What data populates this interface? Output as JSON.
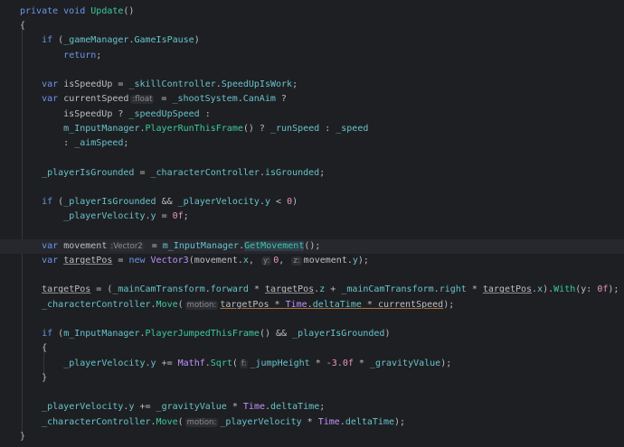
{
  "editor": {
    "current_line": 16,
    "lines": [
      [
        [
          "private void ",
          "k"
        ],
        [
          "Update",
          "m"
        ],
        [
          "()",
          "t"
        ]
      ],
      [
        [
          "{",
          "t"
        ]
      ],
      [
        [
          "    ",
          "t"
        ],
        [
          "if ",
          "k"
        ],
        [
          "(",
          "t"
        ],
        [
          "_gameManager",
          "f"
        ],
        [
          ".",
          "t"
        ],
        [
          "GameIsPause",
          "f"
        ],
        [
          ")",
          "t"
        ]
      ],
      [
        [
          "        ",
          "t"
        ],
        [
          "return",
          "k"
        ],
        [
          ";",
          "t"
        ]
      ],
      [],
      [
        [
          "    ",
          "t"
        ],
        [
          "var ",
          "k"
        ],
        [
          "isSpeedUp = ",
          "t"
        ],
        [
          "_skillController",
          "f"
        ],
        [
          ".",
          "t"
        ],
        [
          "SpeedUpIsWork",
          "f"
        ],
        [
          ";",
          "t"
        ]
      ],
      [
        [
          "    ",
          "t"
        ],
        [
          "var ",
          "k"
        ],
        [
          "currentSpeed",
          "t"
        ],
        [
          ":float",
          "h"
        ],
        [
          " = ",
          "t"
        ],
        [
          "_shootSystem",
          "f"
        ],
        [
          ".",
          "t"
        ],
        [
          "CanAim",
          "f"
        ],
        [
          " ?",
          "t"
        ]
      ],
      [
        [
          "        isSpeedUp ? ",
          "t"
        ],
        [
          "_speedUpSpeed",
          "f"
        ],
        [
          " :",
          "t"
        ]
      ],
      [
        [
          "        ",
          "t"
        ],
        [
          "m_InputManager",
          "f"
        ],
        [
          ".",
          "t"
        ],
        [
          "PlayerRunThisFrame",
          "m"
        ],
        [
          "() ? ",
          "t"
        ],
        [
          "_runSpeed",
          "f"
        ],
        [
          " : ",
          "t"
        ],
        [
          "_speed",
          "f"
        ]
      ],
      [
        [
          "        : ",
          "t"
        ],
        [
          "_aimSpeed",
          "f"
        ],
        [
          ";",
          "t"
        ]
      ],
      [],
      [
        [
          "    ",
          "t"
        ],
        [
          "_playerIsGrounded",
          "f"
        ],
        [
          " = ",
          "t"
        ],
        [
          "_characterController",
          "f"
        ],
        [
          ".",
          "t"
        ],
        [
          "isGrounded",
          "f"
        ],
        [
          ";",
          "t"
        ]
      ],
      [],
      [
        [
          "    ",
          "t"
        ],
        [
          "if ",
          "k"
        ],
        [
          "(",
          "t"
        ],
        [
          "_playerIsGrounded",
          "f"
        ],
        [
          " && ",
          "t"
        ],
        [
          "_playerVelocity",
          "f"
        ],
        [
          ".",
          "t"
        ],
        [
          "y",
          "f"
        ],
        [
          " < ",
          "t"
        ],
        [
          "0",
          "n"
        ],
        [
          ")",
          "t"
        ]
      ],
      [
        [
          "        ",
          "t"
        ],
        [
          "_playerVelocity",
          "f"
        ],
        [
          ".",
          "t"
        ],
        [
          "y",
          "f"
        ],
        [
          " = ",
          "t"
        ],
        [
          "0f",
          "n"
        ],
        [
          ";",
          "t"
        ]
      ],
      [],
      [
        [
          "    ",
          "t"
        ],
        [
          "var ",
          "k"
        ],
        [
          "movement",
          "t"
        ],
        [
          ":Vector2",
          "h"
        ],
        [
          " = ",
          "t"
        ],
        [
          "m_InputManager",
          "f"
        ],
        [
          ".",
          "t"
        ],
        [
          "GetMovement",
          "m hl"
        ],
        [
          "();",
          "t"
        ]
      ],
      [
        [
          "    ",
          "t"
        ],
        [
          "var ",
          "k"
        ],
        [
          "targetPos",
          "u"
        ],
        [
          " = ",
          "t"
        ],
        [
          "new ",
          "k"
        ],
        [
          "Vector3",
          "c"
        ],
        [
          "(movement.",
          "t"
        ],
        [
          "x",
          "f"
        ],
        [
          ", ",
          "t"
        ],
        [
          "y:",
          "h"
        ],
        [
          "0",
          "n"
        ],
        [
          ", ",
          "t"
        ],
        [
          "z:",
          "h"
        ],
        [
          "movement.",
          "t"
        ],
        [
          "y",
          "f"
        ],
        [
          ");",
          "t"
        ]
      ],
      [],
      [
        [
          "    ",
          "t"
        ],
        [
          "targetPos",
          "u"
        ],
        [
          " = (",
          "t"
        ],
        [
          "_mainCamTransform",
          "f"
        ],
        [
          ".",
          "t"
        ],
        [
          "forward",
          "f"
        ],
        [
          " * ",
          "t"
        ],
        [
          "targetPos",
          "u"
        ],
        [
          ".",
          "t"
        ],
        [
          "z",
          "f"
        ],
        [
          " + ",
          "t"
        ],
        [
          "_mainCamTransform",
          "f"
        ],
        [
          ".",
          "t"
        ],
        [
          "right",
          "f"
        ],
        [
          " * ",
          "t"
        ],
        [
          "targetPos",
          "u"
        ],
        [
          ".",
          "t"
        ],
        [
          "x",
          "f"
        ],
        [
          ").",
          "t"
        ],
        [
          "With",
          "m"
        ],
        [
          "(y: ",
          "t"
        ],
        [
          "0f",
          "n"
        ],
        [
          ");",
          "t"
        ]
      ],
      [
        [
          "    ",
          "t"
        ],
        [
          "_characterController",
          "f"
        ],
        [
          ".",
          "t"
        ],
        [
          "Move",
          "m"
        ],
        [
          "(",
          "t"
        ],
        [
          "motion:",
          "h"
        ],
        [
          "targetPos",
          "u w"
        ],
        [
          " * ",
          "t w"
        ],
        [
          "Time",
          "c w"
        ],
        [
          ".",
          "t w"
        ],
        [
          "deltaTime",
          "f w"
        ],
        [
          " * ",
          "t w"
        ],
        [
          "currentSpeed",
          "t w"
        ],
        [
          ");",
          "t"
        ]
      ],
      [],
      [
        [
          "    ",
          "t"
        ],
        [
          "if ",
          "k"
        ],
        [
          "(",
          "t"
        ],
        [
          "m_InputManager",
          "f"
        ],
        [
          ".",
          "t"
        ],
        [
          "PlayerJumpedThisFrame",
          "m"
        ],
        [
          "() && ",
          "t"
        ],
        [
          "_playerIsGrounded",
          "f"
        ],
        [
          ")",
          "t"
        ]
      ],
      [
        [
          "    {",
          "t"
        ]
      ],
      [
        [
          "        ",
          "t"
        ],
        [
          "_playerVelocity",
          "f"
        ],
        [
          ".",
          "t"
        ],
        [
          "y",
          "f"
        ],
        [
          " += ",
          "t"
        ],
        [
          "Mathf",
          "c"
        ],
        [
          ".",
          "t"
        ],
        [
          "Sqrt",
          "m"
        ],
        [
          "(",
          "t"
        ],
        [
          "f:",
          "h"
        ],
        [
          "_jumpHeight",
          "f"
        ],
        [
          " * ",
          "t"
        ],
        [
          "-3.0f",
          "n"
        ],
        [
          " * ",
          "t"
        ],
        [
          "_gravityValue",
          "f"
        ],
        [
          ");",
          "t"
        ]
      ],
      [
        [
          "    }",
          "t"
        ]
      ],
      [],
      [
        [
          "    ",
          "t"
        ],
        [
          "_playerVelocity",
          "f"
        ],
        [
          ".",
          "t"
        ],
        [
          "y",
          "f"
        ],
        [
          " += ",
          "t"
        ],
        [
          "_gravityValue",
          "f"
        ],
        [
          " * ",
          "t"
        ],
        [
          "Time",
          "c"
        ],
        [
          ".",
          "t"
        ],
        [
          "deltaTime",
          "f"
        ],
        [
          ";",
          "t"
        ]
      ],
      [
        [
          "    ",
          "t"
        ],
        [
          "_characterController",
          "f"
        ],
        [
          ".",
          "t"
        ],
        [
          "Move",
          "m"
        ],
        [
          "(",
          "t"
        ],
        [
          "motion:",
          "h"
        ],
        [
          "_playerVelocity",
          "f"
        ],
        [
          " * ",
          "t"
        ],
        [
          "Time",
          "c"
        ],
        [
          ".",
          "t"
        ],
        [
          "deltaTime",
          "f"
        ],
        [
          ");",
          "t"
        ]
      ],
      [
        [
          "}",
          "t"
        ]
      ]
    ]
  }
}
